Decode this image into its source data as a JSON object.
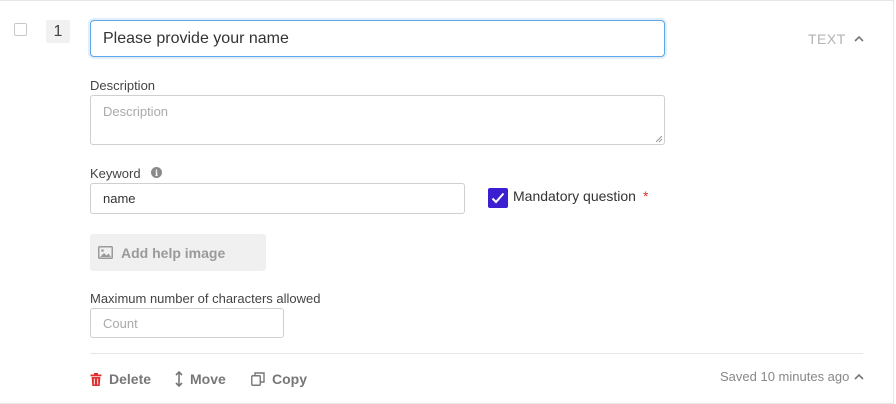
{
  "question": {
    "number": "1",
    "title_value": "Please provide your name",
    "type_label": "TEXT"
  },
  "description": {
    "label": "Description",
    "placeholder": "Description"
  },
  "keyword": {
    "label": "Keyword",
    "value": "name"
  },
  "mandatory": {
    "label": "Mandatory question",
    "required_mark": "*",
    "checked": true
  },
  "help_image": {
    "label": "Add help image"
  },
  "max_chars": {
    "label": "Maximum number of characters allowed",
    "placeholder": "Count"
  },
  "actions": {
    "delete_label": "Delete",
    "move_label": "Move",
    "copy_label": "Copy"
  },
  "status": {
    "saved_text": "Saved 10 minutes ago"
  },
  "colors": {
    "accent": "#3b1fd1",
    "delete_icon": "#e0302f",
    "focus_border": "#5ea6e6"
  },
  "icons": [
    "chevron-up-icon",
    "info-icon",
    "check-icon",
    "image-icon",
    "trash-icon",
    "move-vertical-icon",
    "copy-icon"
  ]
}
